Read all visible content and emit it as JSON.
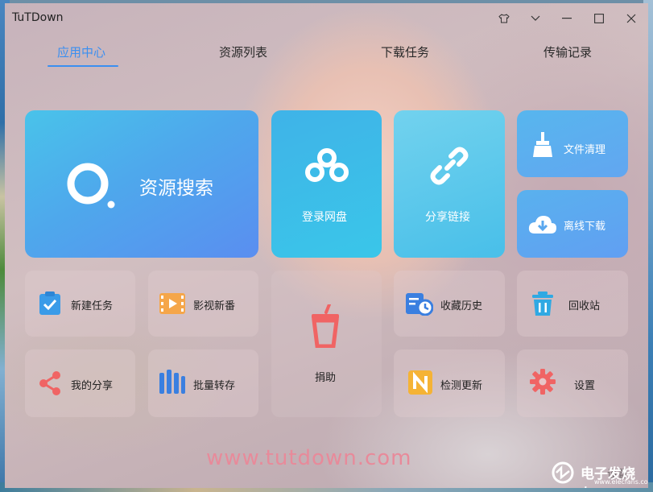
{
  "window": {
    "title": "TuTDown"
  },
  "titlebar_icons": [
    "shirt-icon",
    "chevron-down-icon",
    "minimize-icon",
    "maximize-icon",
    "close-icon"
  ],
  "tabs": [
    {
      "label": "应用中心",
      "active": true
    },
    {
      "label": "资源列表",
      "active": false
    },
    {
      "label": "下载任务",
      "active": false
    },
    {
      "label": "传输记录",
      "active": false
    }
  ],
  "tiles": {
    "search": "资源搜索",
    "login": "登录网盘",
    "share": "分享链接",
    "clean": "文件清理",
    "offline": "离线下载"
  },
  "small_tiles": {
    "new_task": "新建任务",
    "video": "影视新番",
    "donate": "捐助",
    "history": "收藏历史",
    "recycle": "回收站",
    "my_share": "我的分享",
    "batch": "批量转存",
    "update": "检测更新",
    "settings": "设置"
  },
  "overlay": {
    "watermark": "www.tutdown.com",
    "corner_brand": "电子发烧友",
    "corner_url": "www.elecfans.com",
    "ghost_label": "设置"
  },
  "colors": {
    "accent": "#3a8ff0",
    "watermark": "#e88a9a"
  }
}
